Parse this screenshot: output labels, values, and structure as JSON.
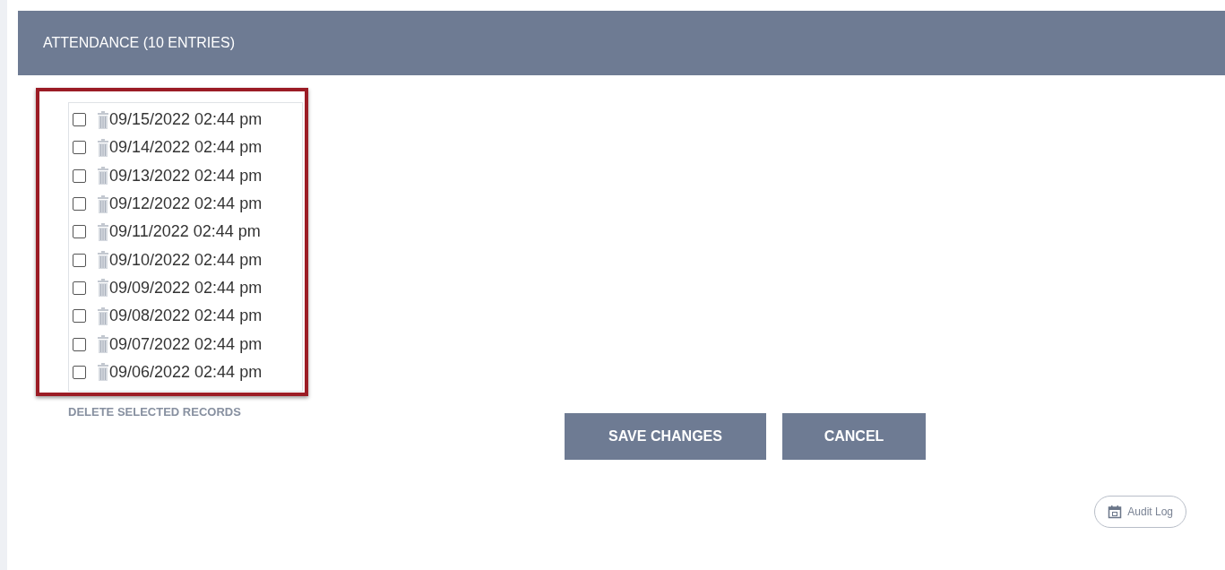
{
  "header": {
    "title": "ATTENDANCE (10 ENTRIES)"
  },
  "records": [
    {
      "label": "09/15/2022 02:44 pm",
      "checked": false
    },
    {
      "label": "09/14/2022 02:44 pm",
      "checked": false
    },
    {
      "label": "09/13/2022 02:44 pm",
      "checked": false
    },
    {
      "label": "09/12/2022 02:44 pm",
      "checked": false
    },
    {
      "label": "09/11/2022 02:44 pm",
      "checked": false
    },
    {
      "label": "09/10/2022 02:44 pm",
      "checked": false
    },
    {
      "label": "09/09/2022 02:44 pm",
      "checked": false
    },
    {
      "label": "09/08/2022 02:44 pm",
      "checked": false
    },
    {
      "label": "09/07/2022 02:44 pm",
      "checked": false
    },
    {
      "label": "09/06/2022 02:44 pm",
      "checked": false
    }
  ],
  "delete_link": "DELETE SELECTED RECORDS",
  "buttons": [
    "SAVE CHANGES",
    "CANCEL"
  ],
  "audit_log": "Audit Log"
}
